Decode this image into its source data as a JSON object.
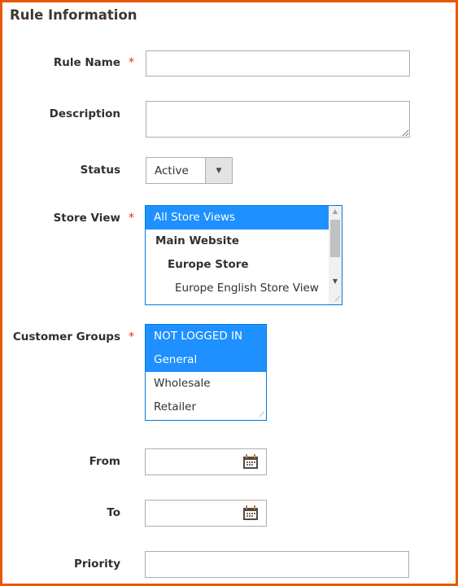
{
  "section_title": "Rule Information",
  "fields": {
    "rule_name": {
      "label": "Rule Name",
      "required": true,
      "value": ""
    },
    "description": {
      "label": "Description",
      "value": ""
    },
    "status": {
      "label": "Status",
      "value": "Active"
    },
    "store_view": {
      "label": "Store View",
      "required": true,
      "options": [
        "All Store Views",
        "Main Website",
        "Europe Store",
        "Europe English Store View"
      ],
      "selected": [
        "All Store Views"
      ]
    },
    "customer_groups": {
      "label": "Customer Groups",
      "required": true,
      "options": [
        "NOT LOGGED IN",
        "General",
        "Wholesale",
        "Retailer"
      ],
      "selected": [
        "NOT LOGGED IN",
        "General"
      ]
    },
    "from": {
      "label": "From",
      "value": ""
    },
    "to": {
      "label": "To",
      "value": ""
    },
    "priority": {
      "label": "Priority",
      "value": ""
    }
  },
  "required_marker": "*",
  "colors": {
    "selected": "#1e90ff",
    "required": "#e22626",
    "frame": "#e8590c"
  }
}
